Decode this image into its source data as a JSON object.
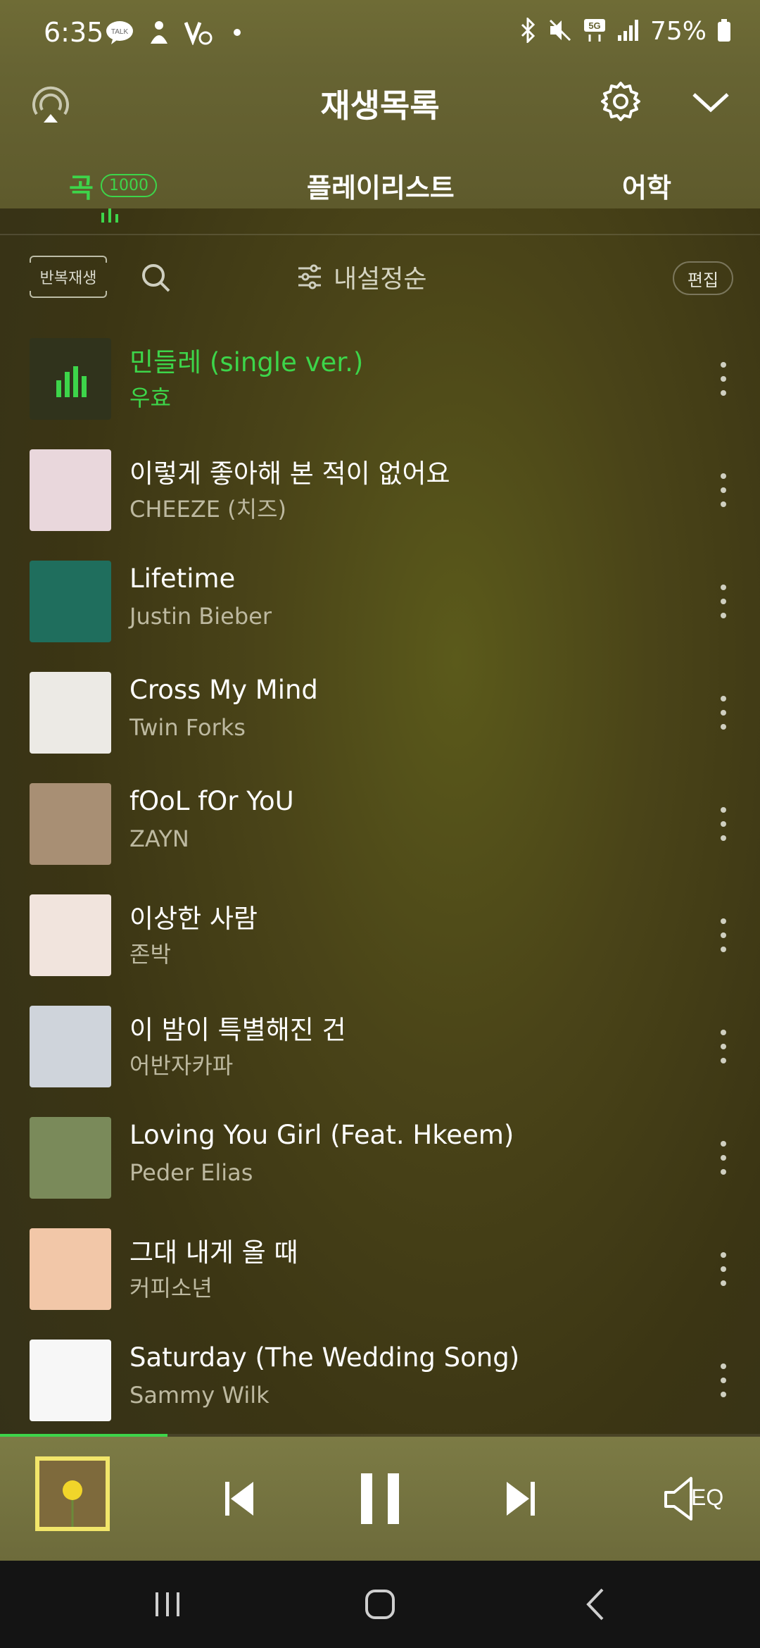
{
  "status_bar": {
    "time": "6:35",
    "kakao_badge": "TALK",
    "battery": "75%",
    "network": "5G"
  },
  "header": {
    "title": "재생목록"
  },
  "tabs": [
    {
      "label": "곡",
      "count": "1000"
    },
    {
      "label": "플레이리스트"
    },
    {
      "label": "어학"
    }
  ],
  "toolbar": {
    "repeat_label": "반복재생",
    "sort_label": "내설정순",
    "edit_label": "편집"
  },
  "songs": [
    {
      "title": "민들레 (single ver.)",
      "artist": "우효",
      "playing": true,
      "art_color": "#4b4f2b"
    },
    {
      "title": "이렇게 좋아해 본 적이 없어요",
      "artist": "CHEEZE (치즈)",
      "art_color": "#e9d7dc"
    },
    {
      "title": "Lifetime",
      "artist": "Justin Bieber",
      "art_color": "#1f6e5d"
    },
    {
      "title": "Cross My Mind",
      "artist": "Twin Forks",
      "art_color": "#eceae5"
    },
    {
      "title": "fOoL fOr YoU",
      "artist": "ZAYN",
      "art_color": "#a88f74"
    },
    {
      "title": "이상한 사람",
      "artist": "존박",
      "art_color": "#f1e4dd"
    },
    {
      "title": "이 밤이 특별해진 건",
      "artist": "어반자카파",
      "art_color": "#cfd4db"
    },
    {
      "title": "Loving You Girl (Feat. Hkeem)",
      "artist": "Peder Elias",
      "art_color": "#7a8a5a"
    },
    {
      "title": "그대 내게 올 때",
      "artist": "커피소년",
      "art_color": "#f2c7a8"
    },
    {
      "title": "Saturday (The Wedding Song)",
      "artist": "Sammy Wilk",
      "art_color": "#f7f7f7"
    }
  ],
  "player": {
    "progress": 0.22,
    "eq_label": "EQ"
  },
  "colors": {
    "accent": "#3dd54a"
  }
}
